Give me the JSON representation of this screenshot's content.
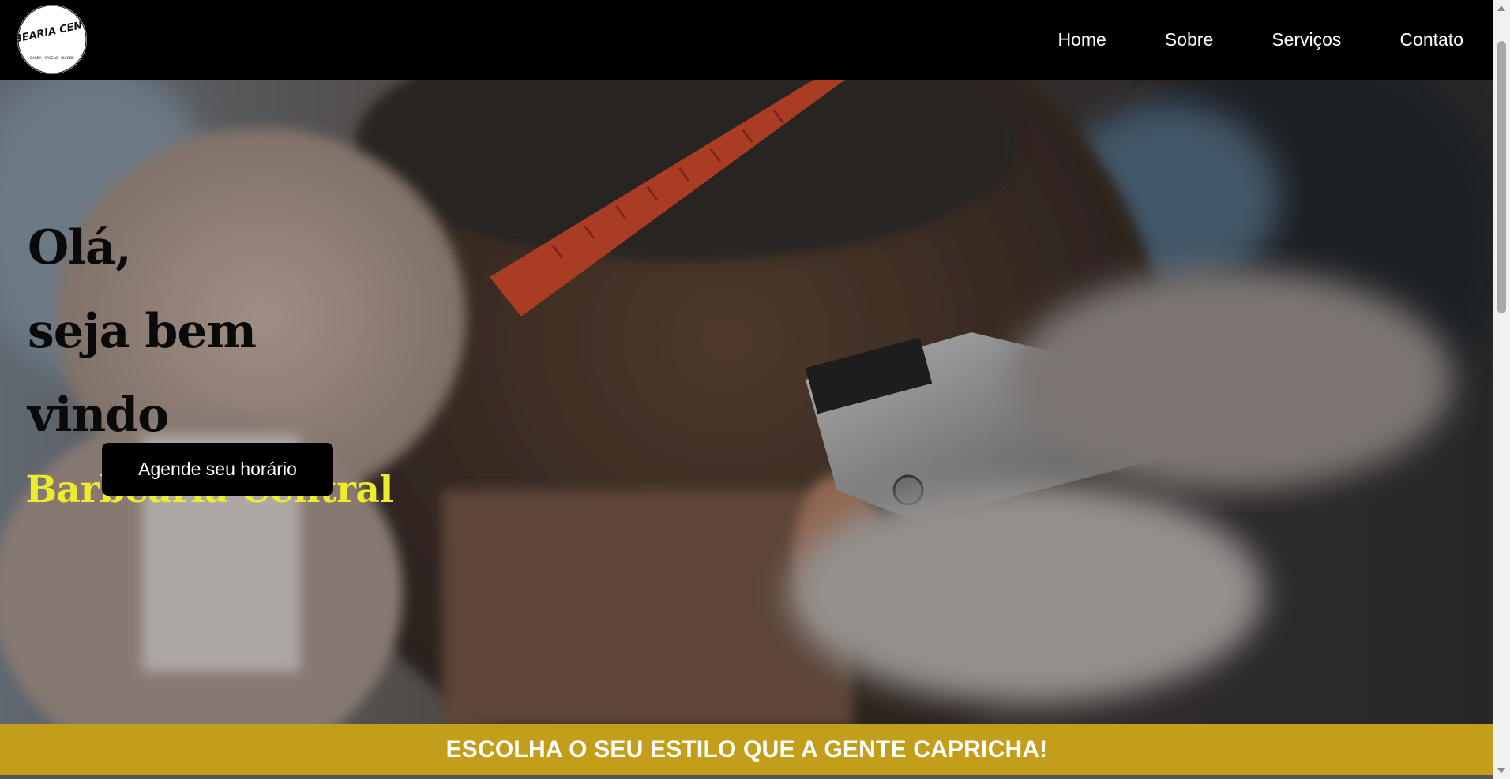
{
  "header": {
    "logo_text": "BARBEARIA CENTRAL",
    "logo_tagline": "BARBA · CABELO · BIGODE",
    "nav": [
      {
        "label": "Home"
      },
      {
        "label": "Sobre"
      },
      {
        "label": "Serviços"
      },
      {
        "label": "Contato"
      }
    ]
  },
  "hero": {
    "greeting_line1": "Olá,",
    "greeting_line2": "seja bem vindo",
    "brand": "Barbearia Central",
    "cta_label": "Agende seu horário",
    "background_image": "barber-haircut-photo"
  },
  "banner": {
    "text": "ESCOLHA O SEU ESTILO QUE A GENTE CAPRICHA!"
  },
  "colors": {
    "header_bg": "#000000",
    "brand_yellow": "#ecec2e",
    "banner_gold": "#c29e1a",
    "cta_bg": "#000000"
  }
}
